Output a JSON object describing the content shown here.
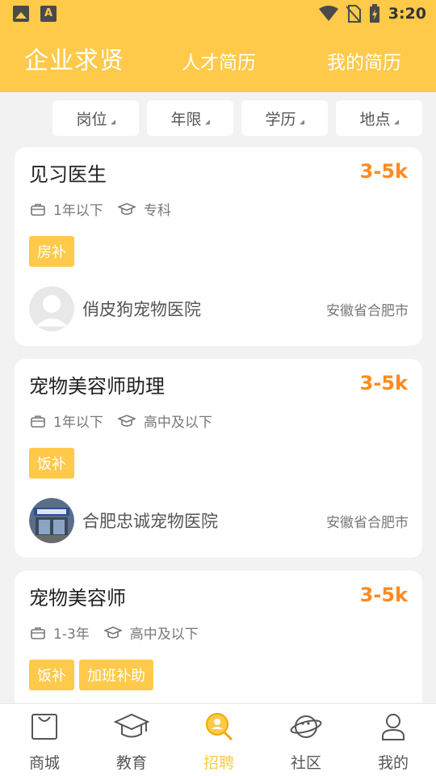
{
  "status_bar": {
    "time": "3:20"
  },
  "header": {
    "title": "企业求贤",
    "tabs": [
      "人才简历",
      "我的简历"
    ]
  },
  "filters": [
    {
      "label": "岗位"
    },
    {
      "label": "年限"
    },
    {
      "label": "学历"
    },
    {
      "label": "地点"
    }
  ],
  "jobs": [
    {
      "title": "见习医生",
      "salary": "3-5k",
      "experience": "1年以下",
      "education": "专科",
      "tags": [
        "房补"
      ],
      "company": "俏皮狗宠物医院",
      "location": "安徽省合肥市",
      "avatar": "default-avatar"
    },
    {
      "title": "宠物美容师助理",
      "salary": "3-5k",
      "experience": "1年以下",
      "education": "高中及以下",
      "tags": [
        "饭补"
      ],
      "company": "合肥忠诚宠物医院",
      "location": "安徽省合肥市",
      "avatar": "storefront-photo"
    },
    {
      "title": "宠物美容师",
      "salary": "3-5k",
      "experience": "1-3年",
      "education": "高中及以下",
      "tags": [
        "饭补",
        "加班补助"
      ]
    }
  ],
  "tabbar": [
    {
      "label": "商城",
      "icon": "shopping-bag-icon",
      "active": false
    },
    {
      "label": "教育",
      "icon": "graduation-cap-icon",
      "active": false
    },
    {
      "label": "招聘",
      "icon": "recruit-search-icon",
      "active": true
    },
    {
      "label": "社区",
      "icon": "planet-icon",
      "active": false
    },
    {
      "label": "我的",
      "icon": "user-icon",
      "active": false
    }
  ],
  "colors": {
    "accent": "#ffc94a",
    "salary": "#ff8a1f",
    "background": "#f2f2f2"
  }
}
